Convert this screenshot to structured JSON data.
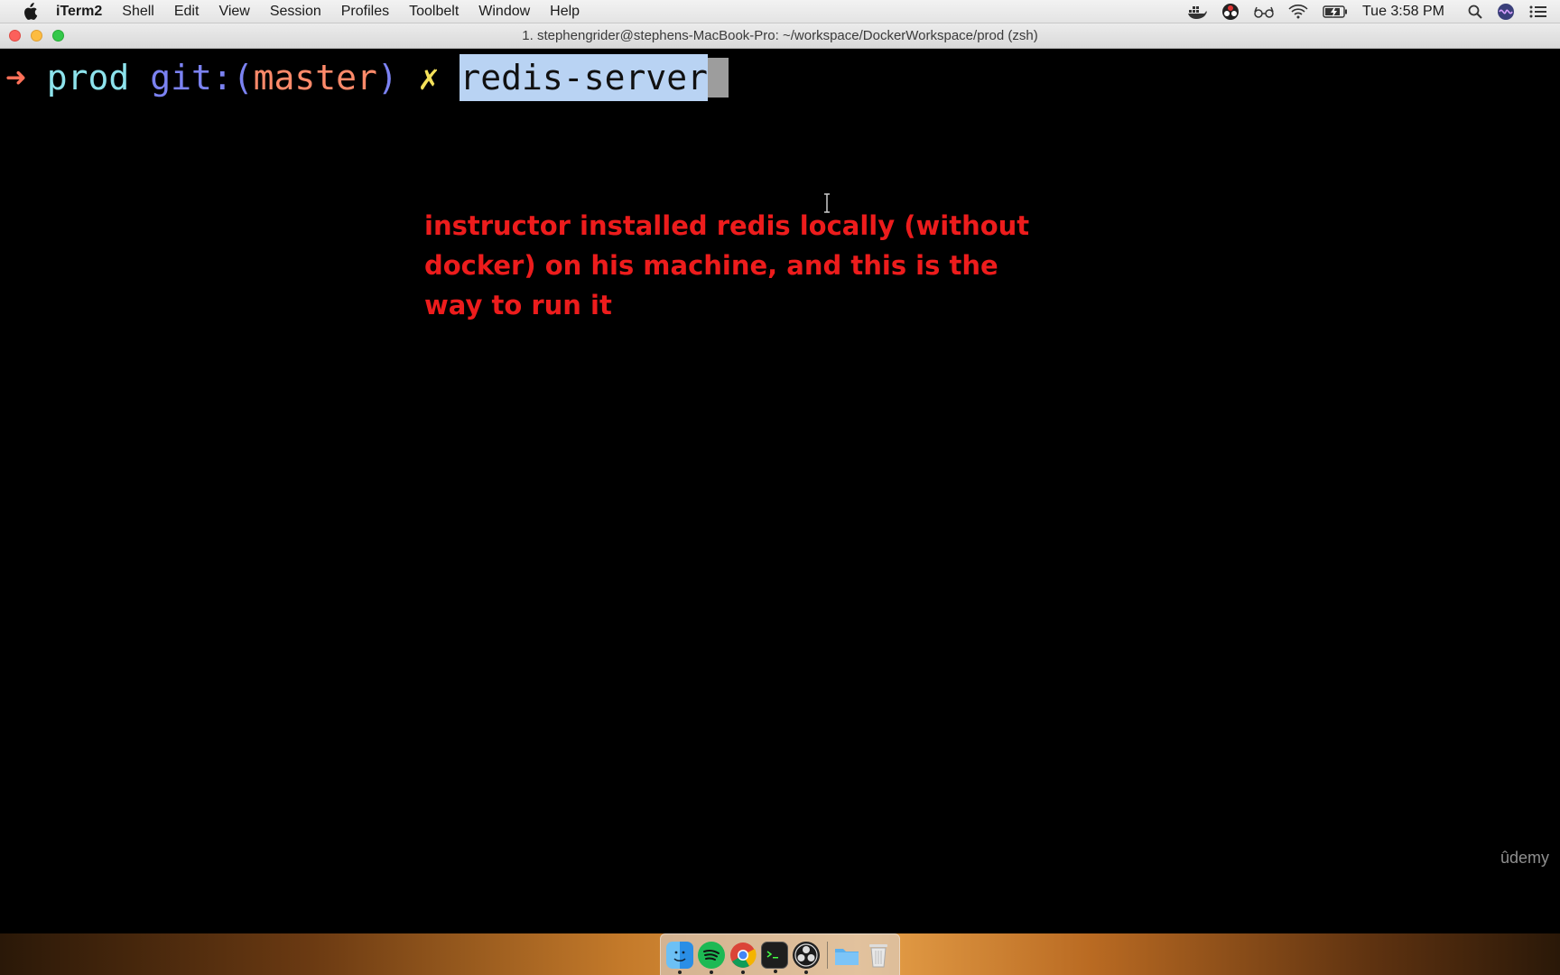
{
  "menubar": {
    "app_name": "iTerm2",
    "items": [
      "Shell",
      "Edit",
      "View",
      "Session",
      "Profiles",
      "Toolbelt",
      "Window",
      "Help"
    ],
    "clock": "Tue 3:58 PM"
  },
  "window": {
    "title": "1. stephengrider@stephens-MacBook-Pro: ~/workspace/DockerWorkspace/prod (zsh)"
  },
  "terminal": {
    "arrow": "➜",
    "directory": "prod",
    "git_label": "git:(",
    "branch": "master",
    "git_close": ")",
    "dirty_marker": "✗",
    "command": "redis-server"
  },
  "annotation": {
    "text": "instructor installed redis locally (without docker) on his machine, and this is the way to run it"
  },
  "watermark": "ûdemy",
  "colors": {
    "annotation": "#ed1c1c",
    "prompt_arrow": "#ff7058",
    "directory": "#8de3ec",
    "git": "#7b82f2",
    "branch": "#ff8a6a",
    "dirty": "#f4e15a",
    "selection": "#b9d3f3"
  },
  "dock": {
    "icons": [
      "finder-icon",
      "spotify-icon",
      "chrome-icon",
      "terminal-icon",
      "obs-icon",
      "folder-icon",
      "trash-icon"
    ]
  }
}
